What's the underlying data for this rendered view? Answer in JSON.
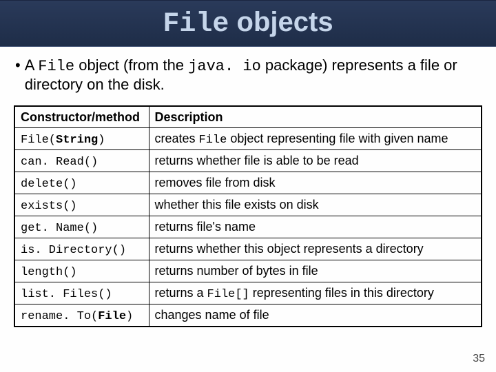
{
  "title": {
    "mono": "File",
    "rest": " objects"
  },
  "bullet": {
    "pre": "A ",
    "code1": "File",
    "mid1": " object (from the ",
    "code2": "java. io",
    "mid2": " package) represents a file or directory on the disk."
  },
  "table": {
    "head": {
      "c1": "Constructor/method",
      "c2": "Description"
    },
    "rows": [
      {
        "m1a": "File(",
        "bold": "String",
        "m1b": ")",
        "d_pre": "creates ",
        "d_code": "File",
        "d_post": " object representing file with given name"
      },
      {
        "m": "can. Read()",
        "d": "returns whether file is able to be read"
      },
      {
        "m": "delete()",
        "d": "removes file from disk"
      },
      {
        "m": "exists()",
        "d": "whether this file exists on disk"
      },
      {
        "m": "get. Name()",
        "d": "returns file's name"
      },
      {
        "m": "is. Directory()",
        "d": "returns whether this object represents a directory"
      },
      {
        "m": "length()",
        "d": "returns number of bytes in file"
      },
      {
        "m": "list. Files()",
        "d_pre": "returns a ",
        "d_code": "File[]",
        "d_post": " representing files in this directory"
      },
      {
        "m1a": "rename. To(",
        "bold": "File",
        "m1b": ")",
        "d": "changes name of file"
      }
    ]
  },
  "pageNumber": "35"
}
